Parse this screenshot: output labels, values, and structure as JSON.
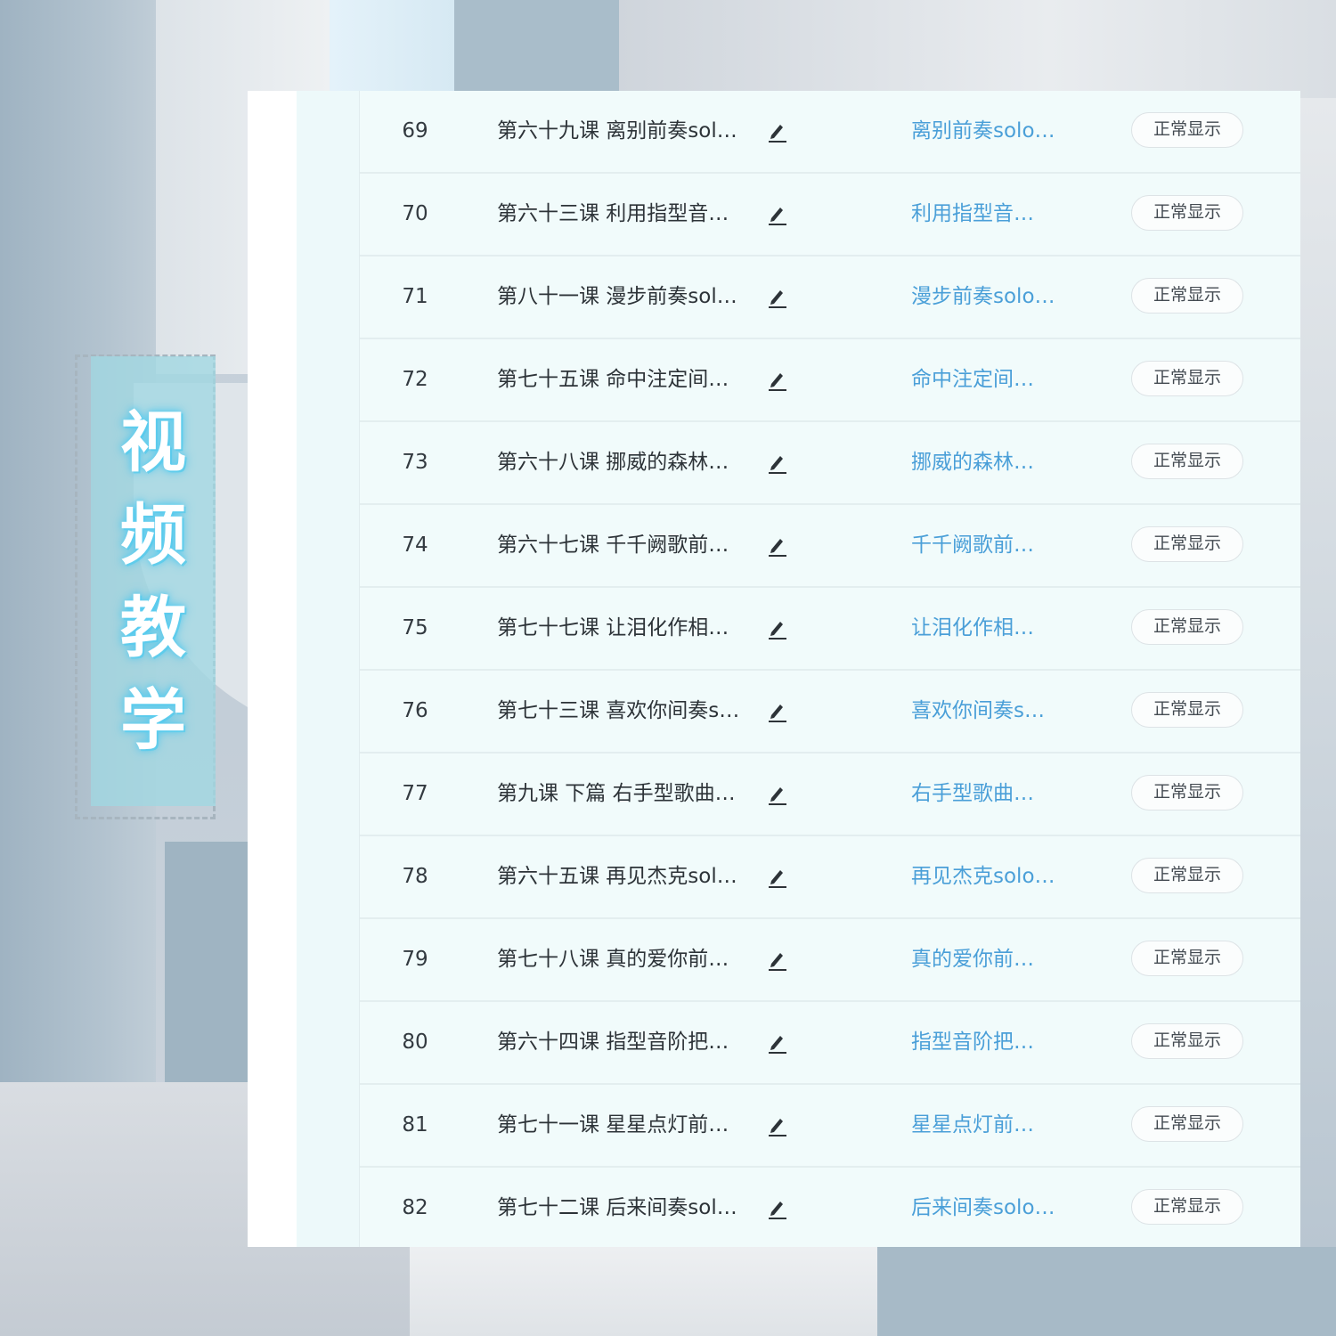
{
  "badge": {
    "chars": [
      "视",
      "频",
      "教",
      "学"
    ]
  },
  "colors": {
    "link": "#4a9fd8",
    "text": "#2d3338",
    "badge_glow": "#5fd0f2"
  },
  "icons": {
    "edit": "pencil-icon"
  },
  "rows": [
    {
      "num": "69",
      "title": "第六十九课 离别前奏sol…",
      "link": "离别前奏solo…",
      "status": "正常显示"
    },
    {
      "num": "70",
      "title": "第六十三课 利用指型音…",
      "link": "利用指型音…",
      "status": "正常显示"
    },
    {
      "num": "71",
      "title": "第八十一课 漫步前奏sol…",
      "link": "漫步前奏solo…",
      "status": "正常显示"
    },
    {
      "num": "72",
      "title": "第七十五课 命中注定间…",
      "link": "命中注定间…",
      "status": "正常显示"
    },
    {
      "num": "73",
      "title": "第六十八课 挪威的森林…",
      "link": "挪威的森林…",
      "status": "正常显示"
    },
    {
      "num": "74",
      "title": "第六十七课 千千阙歌前…",
      "link": "千千阙歌前…",
      "status": "正常显示"
    },
    {
      "num": "75",
      "title": "第七十七课 让泪化作相…",
      "link": "让泪化作相…",
      "status": "正常显示"
    },
    {
      "num": "76",
      "title": "第七十三课 喜欢你间奏s…",
      "link": "喜欢你间奏s…",
      "status": "正常显示"
    },
    {
      "num": "77",
      "title": "第九课 下篇 右手型歌曲…",
      "link": "右手型歌曲…",
      "status": "正常显示"
    },
    {
      "num": "78",
      "title": "第六十五课 再见杰克sol…",
      "link": "再见杰克solo…",
      "status": "正常显示"
    },
    {
      "num": "79",
      "title": "第七十八课 真的爱你前…",
      "link": "真的爱你前…",
      "status": "正常显示"
    },
    {
      "num": "80",
      "title": "第六十四课 指型音阶把…",
      "link": "指型音阶把…",
      "status": "正常显示"
    },
    {
      "num": "81",
      "title": "第七十一课 星星点灯前…",
      "link": "星星点灯前…",
      "status": "正常显示"
    },
    {
      "num": "82",
      "title": "第七十二课 后来间奏sol…",
      "link": "后来间奏solo…",
      "status": "正常显示"
    }
  ]
}
